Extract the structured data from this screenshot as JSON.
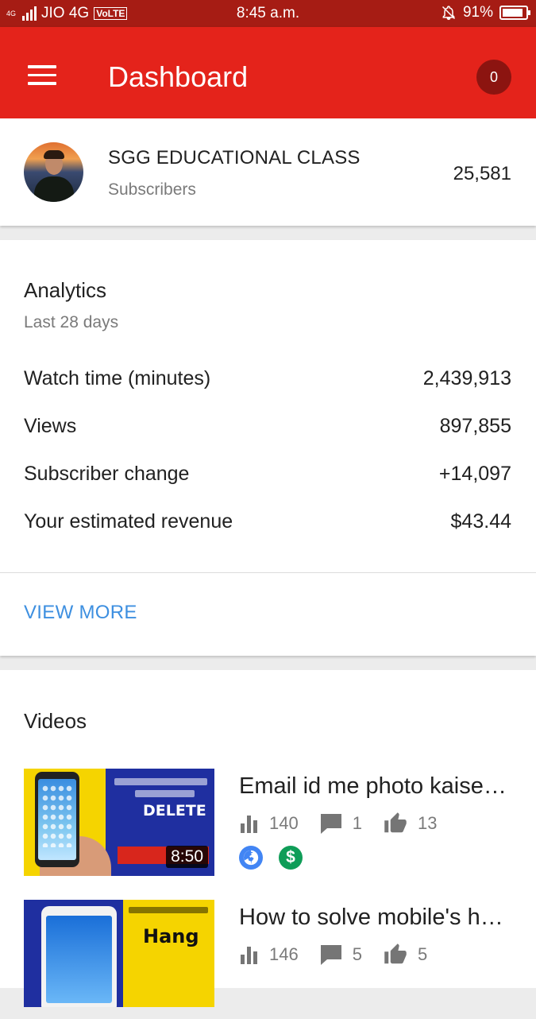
{
  "status_bar": {
    "network_label": "4G",
    "carrier": "JIO 4G",
    "volte": "VoLTE",
    "time": "8:45 a.m.",
    "battery": "91%",
    "battery_level": 0.91
  },
  "app_bar": {
    "title": "Dashboard",
    "notification_count": "0"
  },
  "channel": {
    "name": "SGG EDUCATIONAL CLASS",
    "subscribers_label": "Subscribers",
    "subscribers_count": "25,581"
  },
  "analytics": {
    "heading": "Analytics",
    "period": "Last 28 days",
    "metrics": [
      {
        "label": "Watch time (minutes)",
        "value": "2,439,913"
      },
      {
        "label": "Views",
        "value": "897,855"
      },
      {
        "label": "Subscriber change",
        "value": "+14,097"
      },
      {
        "label": "Your estimated revenue",
        "value": "$43.44"
      }
    ],
    "view_more": "VIEW MORE"
  },
  "videos": {
    "heading": "Videos",
    "items": [
      {
        "title": "Email id me photo kaise delete kare",
        "duration": "8:50",
        "thumb_text": "DELETE",
        "views": "140",
        "comments": "1",
        "likes": "13"
      },
      {
        "title": "How to solve mobile's hang problem",
        "thumb_text": "Hang",
        "views": "146",
        "comments": "5",
        "likes": "5"
      }
    ]
  },
  "colors": {
    "status_bar": "#a61c14",
    "app_bar": "#e4231b",
    "badge": "#8c1410",
    "link": "#3d8fe0",
    "public_icon": "#4285f4",
    "monetized_icon": "#0f9d58"
  }
}
